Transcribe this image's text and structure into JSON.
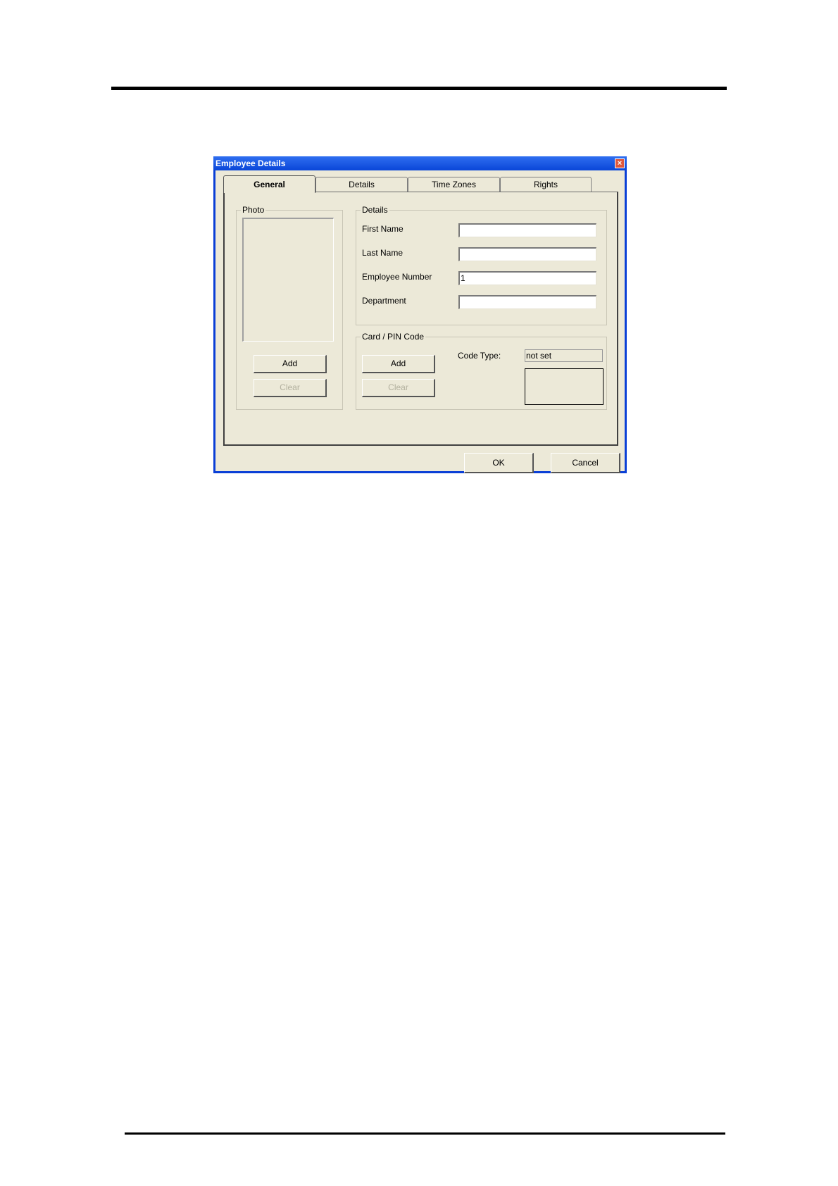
{
  "window": {
    "title": "Employee Details",
    "close_symbol": "×"
  },
  "tabs": [
    {
      "label": "General",
      "active": true
    },
    {
      "label": "Details",
      "active": false
    },
    {
      "label": "Time Zones",
      "active": false
    },
    {
      "label": "Rights",
      "active": false
    }
  ],
  "photo": {
    "group_label": "Photo",
    "add_label": "Add",
    "clear_label": "Clear"
  },
  "details": {
    "group_label": "Details",
    "first_name_label": "First Name",
    "first_name_value": "",
    "last_name_label": "Last Name",
    "last_name_value": "",
    "employee_number_label": "Employee Number",
    "employee_number_value": "1",
    "department_label": "Department",
    "department_value": ""
  },
  "card": {
    "group_label": "Card / PIN Code",
    "add_label": "Add",
    "clear_label": "Clear",
    "code_type_label": "Code Type:",
    "code_type_value": "not set"
  },
  "footer": {
    "ok_label": "OK",
    "cancel_label": "Cancel"
  },
  "colors": {
    "titlebar": "#0a46d8",
    "dialog_background": "#ece9d8",
    "close_button": "#e0573c"
  }
}
